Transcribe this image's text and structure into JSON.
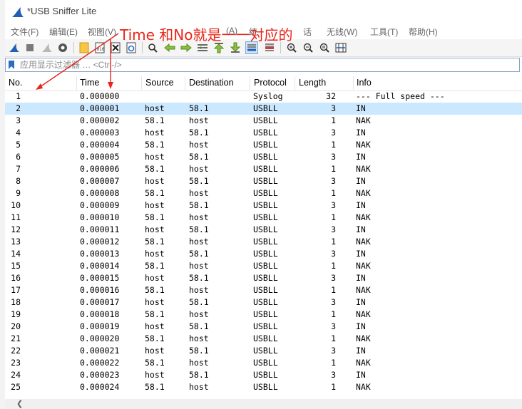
{
  "window": {
    "title": "*USB Sniffer Lite"
  },
  "menu": [
    {
      "label": "文件(F)",
      "id": "file"
    },
    {
      "label": "编辑(E)",
      "id": "edit"
    },
    {
      "label": "视图(V)",
      "id": "view"
    },
    {
      "label": "(A)",
      "id": "analyze"
    },
    {
      "label": "统",
      "id": "stats"
    },
    {
      "label": "话",
      "id": "telephony"
    },
    {
      "label": "无线(W)",
      "id": "wireless"
    },
    {
      "label": "工具(T)",
      "id": "tools"
    },
    {
      "label": "帮助(H)",
      "id": "help"
    }
  ],
  "toolbar": {
    "icons": [
      "shark-fin-start",
      "stop-square",
      "restart-fin",
      "options-gear",
      "open-file",
      "save-file",
      "close-file",
      "reload-file",
      "find-magnifier",
      "go-back-arrow",
      "go-forward-arrow",
      "go-to-packet",
      "go-first-arrow",
      "go-last-arrow",
      "autoscroll",
      "colorize",
      "zoom-in",
      "zoom-out",
      "zoom-normal",
      "resize-columns"
    ],
    "pressed": "autoscroll"
  },
  "filter": {
    "placeholder": "应用显示过滤器 … <Ctrl-/>"
  },
  "table": {
    "columns": [
      "No.",
      "Time",
      "Source",
      "Destination",
      "Protocol",
      "Length",
      "Info"
    ],
    "selected_row_no": "2",
    "rows": [
      {
        "no": "1",
        "time": "0.000000",
        "source": "",
        "destination": "",
        "protocol": "Syslog",
        "length": "32",
        "info": "--- Full speed ---"
      },
      {
        "no": "2",
        "time": "0.000001",
        "source": "host",
        "destination": "58.1",
        "protocol": "USBLL",
        "length": "3",
        "info": "IN"
      },
      {
        "no": "3",
        "time": "0.000002",
        "source": "58.1",
        "destination": "host",
        "protocol": "USBLL",
        "length": "1",
        "info": "NAK"
      },
      {
        "no": "4",
        "time": "0.000003",
        "source": "host",
        "destination": "58.1",
        "protocol": "USBLL",
        "length": "3",
        "info": "IN"
      },
      {
        "no": "5",
        "time": "0.000004",
        "source": "58.1",
        "destination": "host",
        "protocol": "USBLL",
        "length": "1",
        "info": "NAK"
      },
      {
        "no": "6",
        "time": "0.000005",
        "source": "host",
        "destination": "58.1",
        "protocol": "USBLL",
        "length": "3",
        "info": "IN"
      },
      {
        "no": "7",
        "time": "0.000006",
        "source": "58.1",
        "destination": "host",
        "protocol": "USBLL",
        "length": "1",
        "info": "NAK"
      },
      {
        "no": "8",
        "time": "0.000007",
        "source": "host",
        "destination": "58.1",
        "protocol": "USBLL",
        "length": "3",
        "info": "IN"
      },
      {
        "no": "9",
        "time": "0.000008",
        "source": "58.1",
        "destination": "host",
        "protocol": "USBLL",
        "length": "1",
        "info": "NAK"
      },
      {
        "no": "10",
        "time": "0.000009",
        "source": "host",
        "destination": "58.1",
        "protocol": "USBLL",
        "length": "3",
        "info": "IN"
      },
      {
        "no": "11",
        "time": "0.000010",
        "source": "58.1",
        "destination": "host",
        "protocol": "USBLL",
        "length": "1",
        "info": "NAK"
      },
      {
        "no": "12",
        "time": "0.000011",
        "source": "host",
        "destination": "58.1",
        "protocol": "USBLL",
        "length": "3",
        "info": "IN"
      },
      {
        "no": "13",
        "time": "0.000012",
        "source": "58.1",
        "destination": "host",
        "protocol": "USBLL",
        "length": "1",
        "info": "NAK"
      },
      {
        "no": "14",
        "time": "0.000013",
        "source": "host",
        "destination": "58.1",
        "protocol": "USBLL",
        "length": "3",
        "info": "IN"
      },
      {
        "no": "15",
        "time": "0.000014",
        "source": "58.1",
        "destination": "host",
        "protocol": "USBLL",
        "length": "1",
        "info": "NAK"
      },
      {
        "no": "16",
        "time": "0.000015",
        "source": "host",
        "destination": "58.1",
        "protocol": "USBLL",
        "length": "3",
        "info": "IN"
      },
      {
        "no": "17",
        "time": "0.000016",
        "source": "58.1",
        "destination": "host",
        "protocol": "USBLL",
        "length": "1",
        "info": "NAK"
      },
      {
        "no": "18",
        "time": "0.000017",
        "source": "host",
        "destination": "58.1",
        "protocol": "USBLL",
        "length": "3",
        "info": "IN"
      },
      {
        "no": "19",
        "time": "0.000018",
        "source": "58.1",
        "destination": "host",
        "protocol": "USBLL",
        "length": "1",
        "info": "NAK"
      },
      {
        "no": "20",
        "time": "0.000019",
        "source": "host",
        "destination": "58.1",
        "protocol": "USBLL",
        "length": "3",
        "info": "IN"
      },
      {
        "no": "21",
        "time": "0.000020",
        "source": "58.1",
        "destination": "host",
        "protocol": "USBLL",
        "length": "1",
        "info": "NAK"
      },
      {
        "no": "22",
        "time": "0.000021",
        "source": "host",
        "destination": "58.1",
        "protocol": "USBLL",
        "length": "3",
        "info": "IN"
      },
      {
        "no": "23",
        "time": "0.000022",
        "source": "58.1",
        "destination": "host",
        "protocol": "USBLL",
        "length": "1",
        "info": "NAK"
      },
      {
        "no": "24",
        "time": "0.000023",
        "source": "host",
        "destination": "58.1",
        "protocol": "USBLL",
        "length": "3",
        "info": "IN"
      },
      {
        "no": "25",
        "time": "0.000024",
        "source": "58.1",
        "destination": "host",
        "protocol": "USBLL",
        "length": "1",
        "info": "NAK"
      }
    ]
  },
  "annotation": {
    "text": "Time 和No就是一一对应的",
    "color": "#e8251a"
  },
  "colors": {
    "selected_row": "#cce8ff",
    "app_icon": "#1f5fb4"
  }
}
